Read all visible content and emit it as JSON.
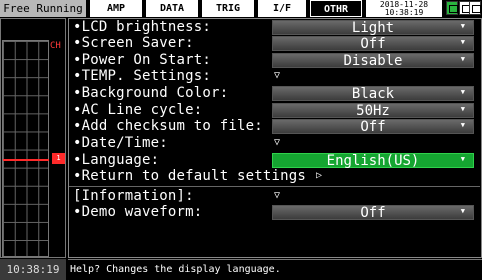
{
  "header": {
    "mode": "Free Running",
    "tabs": [
      {
        "label": "AMP"
      },
      {
        "label": "DATA"
      },
      {
        "label": "TRIG"
      },
      {
        "label": "I/F"
      },
      {
        "label": "OTHR"
      }
    ],
    "date": "2018-11-28",
    "time": "10:38:19",
    "icons": [
      "storage-icon",
      "usb-icon",
      "sd-card-icon",
      "lock-icon"
    ]
  },
  "left_panel": {
    "channel_label": "CH",
    "channel_marker": "1",
    "time_label": "10:38:19"
  },
  "settings": [
    {
      "label": "•LCD brightness:",
      "value": "Light",
      "type": "dropdown"
    },
    {
      "label": "•Screen Saver:",
      "value": "Off",
      "type": "dropdown"
    },
    {
      "label": "•Power On Start:",
      "value": "Disable",
      "type": "dropdown"
    },
    {
      "label": "•TEMP. Settings:",
      "type": "submenu"
    },
    {
      "label": "•Background Color:",
      "value": "Black",
      "type": "dropdown"
    },
    {
      "label": "•AC Line cycle:",
      "value": "50Hz",
      "type": "dropdown"
    },
    {
      "label": "•Add checksum to file:",
      "value": "Off",
      "type": "dropdown"
    },
    {
      "label": "•Date/Time:",
      "type": "submenu"
    },
    {
      "label": "•Language:",
      "value": "English(US)",
      "type": "dropdown",
      "selected": true
    },
    {
      "label": "•Return to default settings",
      "type": "action"
    },
    {
      "label": "[Information]:",
      "type": "submenu"
    },
    {
      "label": "•Demo waveform:",
      "value": "Off",
      "type": "dropdown"
    }
  ],
  "help_text": "Help? Changes the display language.",
  "colors": {
    "selected": "#15a531",
    "trace": "#ff2a2a",
    "background": "#000000"
  }
}
